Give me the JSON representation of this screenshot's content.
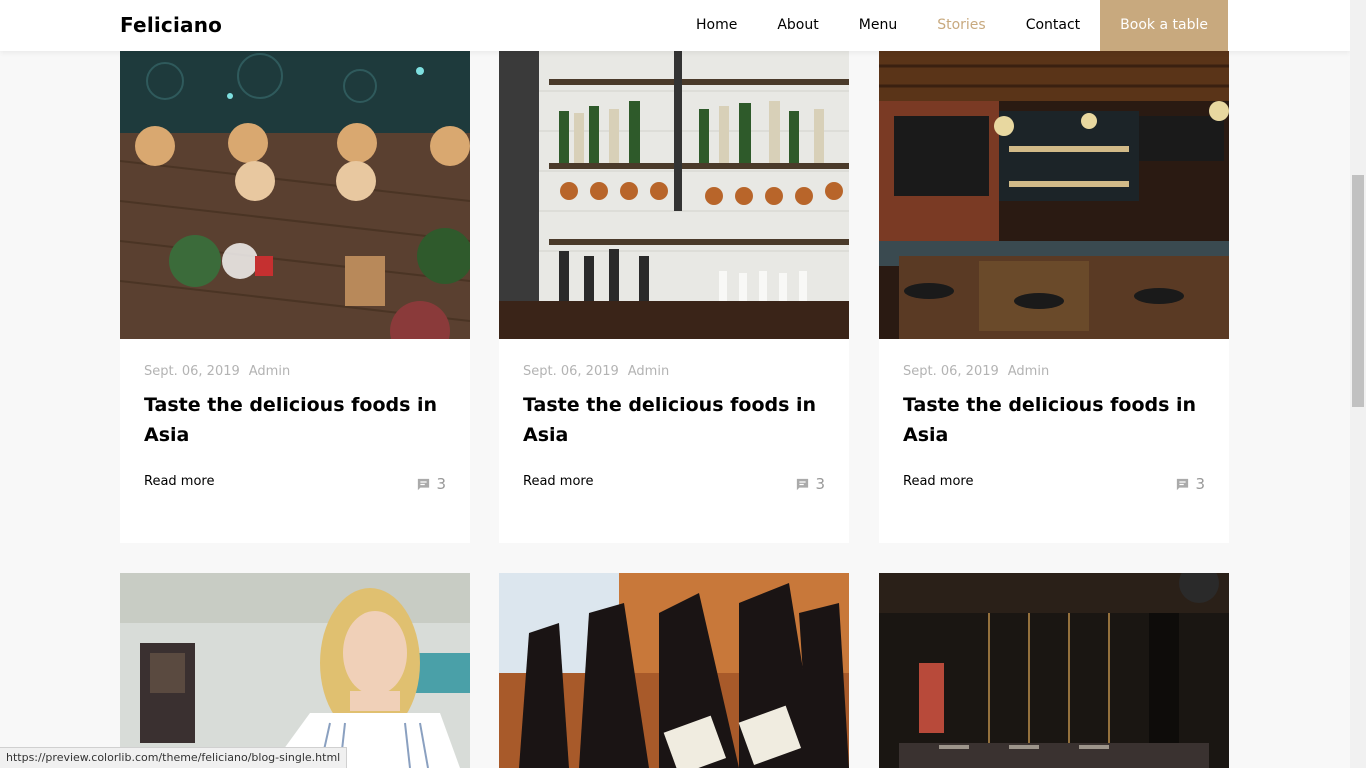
{
  "nav": {
    "brand": "Feliciano",
    "links": [
      {
        "label": "Home"
      },
      {
        "label": "About"
      },
      {
        "label": "Menu"
      },
      {
        "label": "Stories"
      },
      {
        "label": "Contact"
      }
    ],
    "book_label": "Book a table",
    "accent_color": "#c8a97e"
  },
  "posts": [
    {
      "date": "Sept. 06, 2019",
      "author": "Admin",
      "title": "Taste the delicious foods in Asia",
      "read_more": "Read more",
      "comments": "3",
      "image": "restaurant-topview-photo"
    },
    {
      "date": "Sept. 06, 2019",
      "author": "Admin",
      "title": "Taste the delicious foods in Asia",
      "read_more": "Read more",
      "comments": "3",
      "image": "bar-shelves-photo"
    },
    {
      "date": "Sept. 06, 2019",
      "author": "Admin",
      "title": "Taste the delicious foods in Asia",
      "read_more": "Read more",
      "comments": "3",
      "image": "bar-interior-photo"
    }
  ],
  "second_row_images": [
    "barista-woman-photo",
    "wine-bottles-photo",
    "dining-room-photo"
  ],
  "status_url": "https://preview.colorlib.com/theme/feliciano/blog-single.html"
}
